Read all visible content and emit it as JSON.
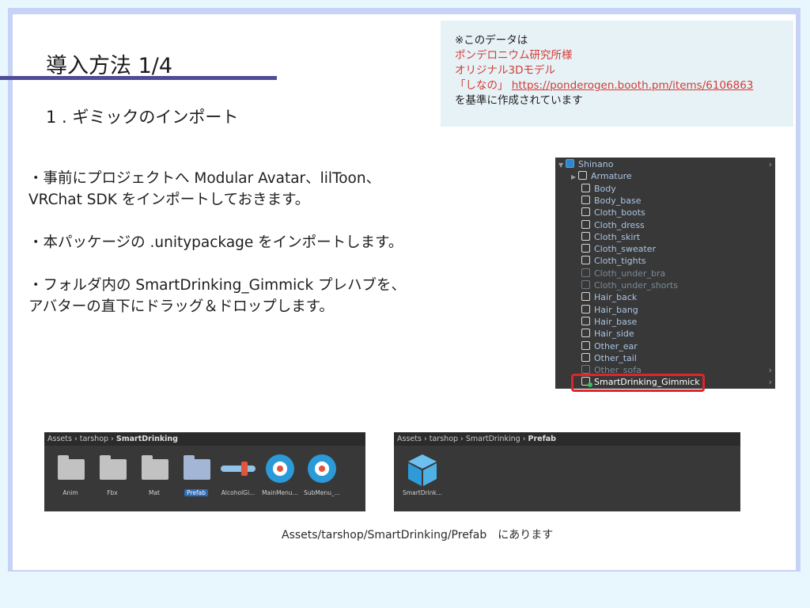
{
  "slide": {
    "title": "導入方法 1/4",
    "subtitle": "1 . ギミックのインポート"
  },
  "note": {
    "line1": "※このデータは",
    "line2": "ポンデロニウム研究所様",
    "line3": "オリジナル3Dモデル",
    "line4_prefix": "「しなの」",
    "link": "https://ponderogen.booth.pm/items/6106863",
    "line5": "を基準に作成されています"
  },
  "body": {
    "p1_l1": "・事前にプロジェクトへ Modular Avatar、lilToon、",
    "p1_l2": "VRChat SDK をインポートしておきます。",
    "p2_l1": "・本パッケージの .unitypackage をインポートします。",
    "p3_l1": "・フォルダ内の SmartDrinking_Gimmick プレハブを、",
    "p3_l2": "アバターの直下にドラッグ＆ドロップします。"
  },
  "hierarchy": {
    "items": [
      {
        "label": "Shinano",
        "icon": "prefab-cube-icon"
      },
      {
        "label": "Armature",
        "icon": "cube-icon"
      },
      {
        "label": "Body",
        "icon": "cube-icon"
      },
      {
        "label": "Body_base",
        "icon": "cube-icon"
      },
      {
        "label": "Cloth_boots",
        "icon": "cube-icon"
      },
      {
        "label": "Cloth_dress",
        "icon": "cube-icon"
      },
      {
        "label": "Cloth_skirt",
        "icon": "cube-icon"
      },
      {
        "label": "Cloth_sweater",
        "icon": "cube-icon"
      },
      {
        "label": "Cloth_tights",
        "icon": "cube-icon"
      },
      {
        "label": "Cloth_under_bra",
        "icon": "cube-icon"
      },
      {
        "label": "Cloth_under_shorts",
        "icon": "cube-icon"
      },
      {
        "label": "Hair_back",
        "icon": "cube-icon"
      },
      {
        "label": "Hair_bang",
        "icon": "cube-icon"
      },
      {
        "label": "Hair_base",
        "icon": "cube-icon"
      },
      {
        "label": "Hair_side",
        "icon": "cube-icon"
      },
      {
        "label": "Other_ear",
        "icon": "cube-icon"
      },
      {
        "label": "Other_tail",
        "icon": "cube-icon"
      },
      {
        "label": "Other_sofa",
        "icon": "cube-icon"
      },
      {
        "label": "SmartDrinking_Gimmick",
        "icon": "prefab-added-icon"
      }
    ]
  },
  "project1": {
    "crumb1": "Assets",
    "crumb2": "tarshop",
    "crumb3": "SmartDrinking",
    "items": [
      "Anim",
      "Fbx",
      "Mat",
      "Prefab",
      "AlcoholGi...",
      "MainMenu...",
      "SubMenu_..."
    ]
  },
  "project2": {
    "crumb1": "Assets",
    "crumb2": "tarshop",
    "crumb3": "SmartDrinking",
    "crumb4": "Prefab",
    "items": [
      "SmartDrink..."
    ]
  },
  "caption": "Assets/tarshop/SmartDrinking/Prefab　にあります",
  "colors": {
    "accent_rule": "#4f4c97",
    "highlight": "#e0252a",
    "note_red": "#d23c35"
  }
}
